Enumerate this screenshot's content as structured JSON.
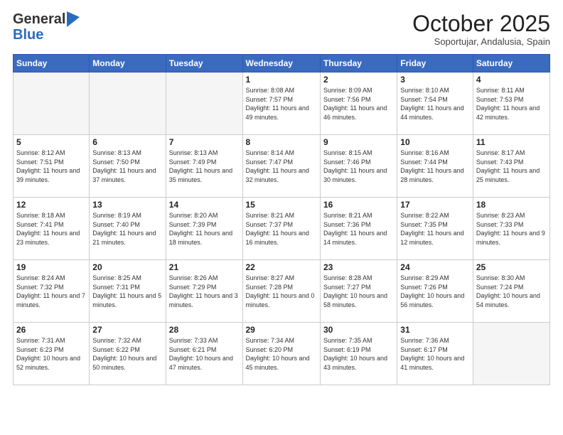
{
  "logo": {
    "general": "General",
    "blue": "Blue"
  },
  "title": "October 2025",
  "subtitle": "Soportujar, Andalusia, Spain",
  "days_of_week": [
    "Sunday",
    "Monday",
    "Tuesday",
    "Wednesday",
    "Thursday",
    "Friday",
    "Saturday"
  ],
  "weeks": [
    [
      {
        "day": "",
        "info": ""
      },
      {
        "day": "",
        "info": ""
      },
      {
        "day": "",
        "info": ""
      },
      {
        "day": "1",
        "info": "Sunrise: 8:08 AM\nSunset: 7:57 PM\nDaylight: 11 hours\nand 49 minutes."
      },
      {
        "day": "2",
        "info": "Sunrise: 8:09 AM\nSunset: 7:56 PM\nDaylight: 11 hours\nand 46 minutes."
      },
      {
        "day": "3",
        "info": "Sunrise: 8:10 AM\nSunset: 7:54 PM\nDaylight: 11 hours\nand 44 minutes."
      },
      {
        "day": "4",
        "info": "Sunrise: 8:11 AM\nSunset: 7:53 PM\nDaylight: 11 hours\nand 42 minutes."
      }
    ],
    [
      {
        "day": "5",
        "info": "Sunrise: 8:12 AM\nSunset: 7:51 PM\nDaylight: 11 hours\nand 39 minutes."
      },
      {
        "day": "6",
        "info": "Sunrise: 8:13 AM\nSunset: 7:50 PM\nDaylight: 11 hours\nand 37 minutes."
      },
      {
        "day": "7",
        "info": "Sunrise: 8:13 AM\nSunset: 7:49 PM\nDaylight: 11 hours\nand 35 minutes."
      },
      {
        "day": "8",
        "info": "Sunrise: 8:14 AM\nSunset: 7:47 PM\nDaylight: 11 hours\nand 32 minutes."
      },
      {
        "day": "9",
        "info": "Sunrise: 8:15 AM\nSunset: 7:46 PM\nDaylight: 11 hours\nand 30 minutes."
      },
      {
        "day": "10",
        "info": "Sunrise: 8:16 AM\nSunset: 7:44 PM\nDaylight: 11 hours\nand 28 minutes."
      },
      {
        "day": "11",
        "info": "Sunrise: 8:17 AM\nSunset: 7:43 PM\nDaylight: 11 hours\nand 25 minutes."
      }
    ],
    [
      {
        "day": "12",
        "info": "Sunrise: 8:18 AM\nSunset: 7:41 PM\nDaylight: 11 hours\nand 23 minutes."
      },
      {
        "day": "13",
        "info": "Sunrise: 8:19 AM\nSunset: 7:40 PM\nDaylight: 11 hours\nand 21 minutes."
      },
      {
        "day": "14",
        "info": "Sunrise: 8:20 AM\nSunset: 7:39 PM\nDaylight: 11 hours\nand 18 minutes."
      },
      {
        "day": "15",
        "info": "Sunrise: 8:21 AM\nSunset: 7:37 PM\nDaylight: 11 hours\nand 16 minutes."
      },
      {
        "day": "16",
        "info": "Sunrise: 8:21 AM\nSunset: 7:36 PM\nDaylight: 11 hours\nand 14 minutes."
      },
      {
        "day": "17",
        "info": "Sunrise: 8:22 AM\nSunset: 7:35 PM\nDaylight: 11 hours\nand 12 minutes."
      },
      {
        "day": "18",
        "info": "Sunrise: 8:23 AM\nSunset: 7:33 PM\nDaylight: 11 hours\nand 9 minutes."
      }
    ],
    [
      {
        "day": "19",
        "info": "Sunrise: 8:24 AM\nSunset: 7:32 PM\nDaylight: 11 hours\nand 7 minutes."
      },
      {
        "day": "20",
        "info": "Sunrise: 8:25 AM\nSunset: 7:31 PM\nDaylight: 11 hours\nand 5 minutes."
      },
      {
        "day": "21",
        "info": "Sunrise: 8:26 AM\nSunset: 7:29 PM\nDaylight: 11 hours\nand 3 minutes."
      },
      {
        "day": "22",
        "info": "Sunrise: 8:27 AM\nSunset: 7:28 PM\nDaylight: 11 hours\nand 0 minutes."
      },
      {
        "day": "23",
        "info": "Sunrise: 8:28 AM\nSunset: 7:27 PM\nDaylight: 10 hours\nand 58 minutes."
      },
      {
        "day": "24",
        "info": "Sunrise: 8:29 AM\nSunset: 7:26 PM\nDaylight: 10 hours\nand 56 minutes."
      },
      {
        "day": "25",
        "info": "Sunrise: 8:30 AM\nSunset: 7:24 PM\nDaylight: 10 hours\nand 54 minutes."
      }
    ],
    [
      {
        "day": "26",
        "info": "Sunrise: 7:31 AM\nSunset: 6:23 PM\nDaylight: 10 hours\nand 52 minutes."
      },
      {
        "day": "27",
        "info": "Sunrise: 7:32 AM\nSunset: 6:22 PM\nDaylight: 10 hours\nand 50 minutes."
      },
      {
        "day": "28",
        "info": "Sunrise: 7:33 AM\nSunset: 6:21 PM\nDaylight: 10 hours\nand 47 minutes."
      },
      {
        "day": "29",
        "info": "Sunrise: 7:34 AM\nSunset: 6:20 PM\nDaylight: 10 hours\nand 45 minutes."
      },
      {
        "day": "30",
        "info": "Sunrise: 7:35 AM\nSunset: 6:19 PM\nDaylight: 10 hours\nand 43 minutes."
      },
      {
        "day": "31",
        "info": "Sunrise: 7:36 AM\nSunset: 6:17 PM\nDaylight: 10 hours\nand 41 minutes."
      },
      {
        "day": "",
        "info": ""
      }
    ]
  ]
}
